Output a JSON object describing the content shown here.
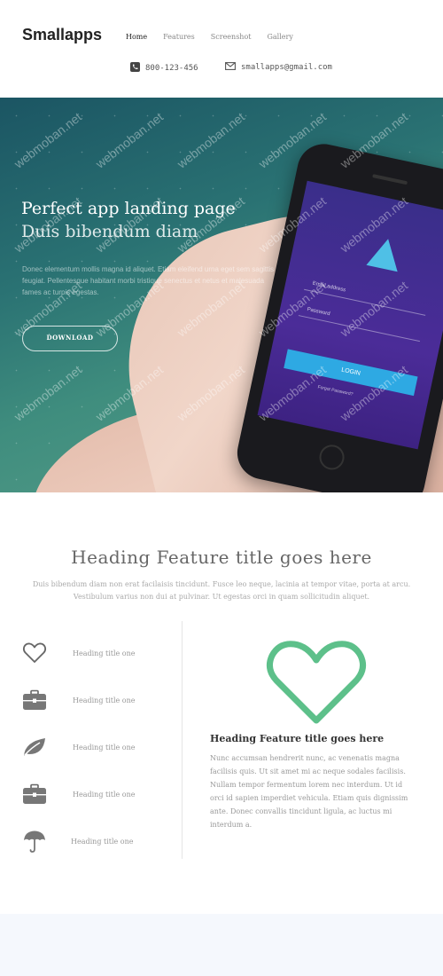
{
  "header": {
    "logo": "Smallapps",
    "nav": [
      "Home",
      "Features",
      "Screenshot",
      "Gallery"
    ],
    "phone": "800-123-456",
    "email": "smallapps@gmail.com"
  },
  "hero": {
    "title": "Perfect app landing page",
    "subtitle": "Duis bibendum diam",
    "text": "Donec elementum mollis magna id aliquet. Etiam eleifend urna eget sem sagittis feugiat. Pellentesque habitant morbi tristique senectus et netus et malesuada fames ac turpis egestas.",
    "button": "DOWNLOAD",
    "watermark": "webmoban.net",
    "app": {
      "field1": "Email address",
      "field2": "Password",
      "button": "LOGIN",
      "sub": "Forgot Password?"
    }
  },
  "features": {
    "heading": "Heading Feature title goes here",
    "desc_line1": "Duis bibendum diam non erat facilaisis tincidunt. Fusce leo neque, lacinia at tempor vitae, porta at arcu.",
    "desc_line2": "Vestibulum varius non dui at pulvinar. Ut egestas orci in quam sollicitudin aliquet.",
    "items": [
      {
        "icon": "heart-icon",
        "label": "Heading title one"
      },
      {
        "icon": "briefcase-icon",
        "label": "Heading title one"
      },
      {
        "icon": "leaf-icon",
        "label": "Heading title one"
      },
      {
        "icon": "briefcase-icon",
        "label": "Heading title one"
      },
      {
        "icon": "umbrella-icon",
        "label": "Heading title one"
      }
    ],
    "detail_title": "Heading Feature title goes here",
    "detail_text": "Nunc accumsan hendrerit nunc, ac venenatis magna facilisis quis. Ut sit amet mi ac neque sodales facilisis. Nullam tempor fermentum lorem nec interdum. Ut id orci id sapien imperdiet vehicula. Etiam quis dignissim ante. Donec convallis tincidunt ligula, ac luctus mi interdum a."
  },
  "colors": {
    "accent": "#5dc08a",
    "hero_start": "#1b5563",
    "hero_end": "#5aa08a"
  }
}
